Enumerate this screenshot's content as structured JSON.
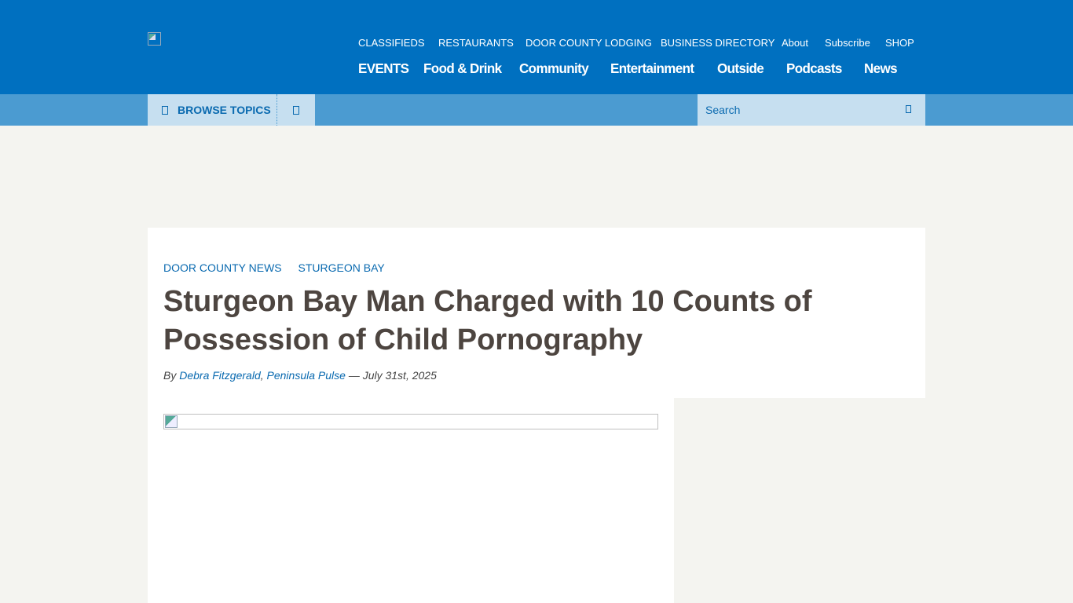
{
  "header": {
    "utility_nav": [
      {
        "label": "CLASSIFIEDS"
      },
      {
        "label": "RESTAURANTS"
      },
      {
        "label": "DOOR COUNTY LODGING"
      },
      {
        "label": "BUSINESS DIRECTORY"
      },
      {
        "label": "About"
      },
      {
        "label": "Subscribe"
      },
      {
        "label": "SHOP"
      }
    ],
    "main_nav": [
      {
        "label": "EVENTS"
      },
      {
        "label": "Food & Drink"
      },
      {
        "label": "Community"
      },
      {
        "label": "Entertainment"
      },
      {
        "label": "Outside"
      },
      {
        "label": "Podcasts"
      },
      {
        "label": "News"
      }
    ],
    "colors": {
      "header_bg": "#0070c0",
      "subbar_bg": "#4b9bd1",
      "link": "#0a6ab0"
    }
  },
  "subbar": {
    "browse_label": "BROWSE TOPICS",
    "search_placeholder": "Search",
    "search_value": ""
  },
  "article": {
    "categories": [
      "DOOR COUNTY NEWS",
      "STURGEON BAY"
    ],
    "title": "Sturgeon Bay Man Charged with 10 Counts of Possession of Child Pornography",
    "byline": {
      "prefix": "By",
      "author": "Debra Fitzgerald",
      "publication": "Peninsula Pulse",
      "separator": "—",
      "date": "July 31st, 2025"
    }
  }
}
